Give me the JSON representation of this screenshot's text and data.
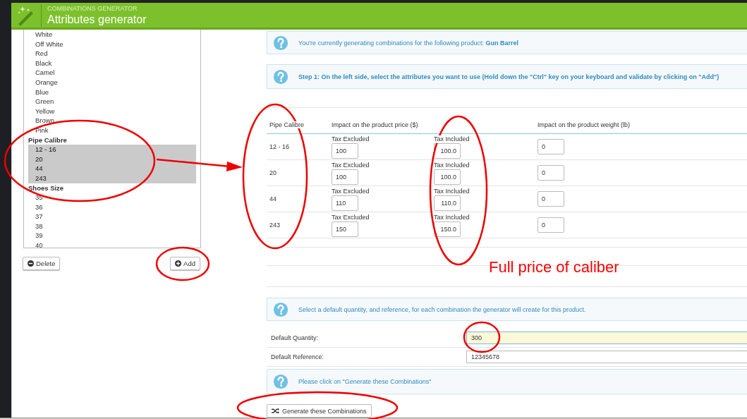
{
  "header": {
    "subtitle": "COMBINATIONS GENERATOR",
    "title": "Attributes generator"
  },
  "attribute_list": {
    "items": [
      {
        "kind": "option",
        "label": "White",
        "selected": false
      },
      {
        "kind": "option",
        "label": "Off White",
        "selected": false
      },
      {
        "kind": "option",
        "label": "Red",
        "selected": false
      },
      {
        "kind": "option",
        "label": "Black",
        "selected": false
      },
      {
        "kind": "option",
        "label": "Camel",
        "selected": false
      },
      {
        "kind": "option",
        "label": "Orange",
        "selected": false
      },
      {
        "kind": "option",
        "label": "Blue",
        "selected": false
      },
      {
        "kind": "option",
        "label": "Green",
        "selected": false
      },
      {
        "kind": "option",
        "label": "Yellow",
        "selected": false
      },
      {
        "kind": "option",
        "label": "Brown",
        "selected": false
      },
      {
        "kind": "option",
        "label": "Pink",
        "selected": false
      },
      {
        "kind": "group",
        "label": "Pipe Calibre"
      },
      {
        "kind": "option",
        "label": "12 - 16",
        "selected": true
      },
      {
        "kind": "option",
        "label": "20",
        "selected": true
      },
      {
        "kind": "option",
        "label": "44",
        "selected": true
      },
      {
        "kind": "option",
        "label": "243",
        "selected": true
      },
      {
        "kind": "group",
        "label": "Shoes Size"
      },
      {
        "kind": "option",
        "label": "35",
        "selected": false
      },
      {
        "kind": "option",
        "label": "36",
        "selected": false
      },
      {
        "kind": "option",
        "label": "37",
        "selected": false
      },
      {
        "kind": "option",
        "label": "38",
        "selected": false
      },
      {
        "kind": "option",
        "label": "39",
        "selected": false
      },
      {
        "kind": "option",
        "label": "40",
        "selected": false
      }
    ]
  },
  "list_buttons": [
    {
      "kind": "delete",
      "label": "Delete"
    },
    {
      "kind": "add",
      "label": "Add"
    }
  ],
  "product_notice": {
    "text": "You're currently generating combinations for the following product: **Gun Barrel**",
    "bold": false
  },
  "step_notice": {
    "text": "Step 1: On the left side, select the attributes you want to use (Hold down the \"Ctrl\" key on your keyboard and validate by clicking on \"Add\")",
    "bold": true
  },
  "table": {
    "columns": [
      "Pipe Calibre",
      "Impact on the product price ($)",
      "Impact on the product weight (lb)"
    ],
    "rows": [
      {
        "value": "12 - 16",
        "tax_excluded_label": "Tax Excluded",
        "tax_excluded": "100",
        "tax_included_label": "Tax Included",
        "tax_included": "100.0",
        "weight": "0"
      },
      {
        "value": "20",
        "tax_excluded_label": "Tax Excluded",
        "tax_excluded": "100",
        "tax_included_label": "Tax Included",
        "tax_included": "100.0",
        "weight": "0"
      },
      {
        "value": "44",
        "tax_excluded_label": "Tax Excluded",
        "tax_excluded": "110",
        "tax_included_label": "Tax Included",
        "tax_included": "110.0",
        "weight": "0"
      },
      {
        "value": "243",
        "tax_excluded_label": "Tax Excluded",
        "tax_excluded": "150",
        "tax_included_label": "Tax Included",
        "tax_included": "150.0",
        "weight": "0"
      }
    ]
  },
  "defaults_notice": {
    "text": "Select a default quantity, and reference, for each combination the generator will create for this product.",
    "bold": false
  },
  "defaults": [
    {
      "label": "Default Quantity:",
      "value": "300",
      "focused": true
    },
    {
      "label": "Default Reference:",
      "value": "12345678",
      "focused": false
    }
  ],
  "generate_notice": {
    "text": "Please click on \"Generate these Combinations\"",
    "bold": false
  },
  "generate_button": {
    "label": "Generate these Combinations"
  },
  "annotation": {
    "text": "Full price of caliber"
  }
}
